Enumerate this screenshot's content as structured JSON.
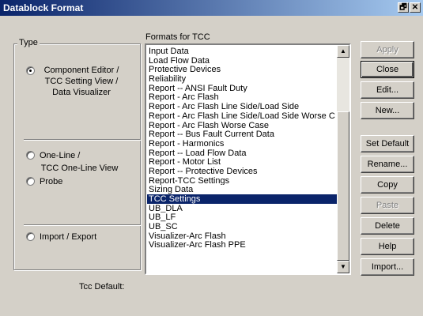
{
  "window": {
    "title": "Datablock Format",
    "restore_glyph": "🗗",
    "close_glyph": "✕"
  },
  "type_group": {
    "legend": "Type",
    "options": [
      {
        "label": "Component Editor /\nTCC Setting View /\nData Visualizer",
        "checked": true
      },
      {
        "label": "One-Line /",
        "sublabel": "TCC One-Line View",
        "checked": false
      },
      {
        "label": "Probe",
        "checked": false
      },
      {
        "label": "Import / Export",
        "checked": false
      }
    ]
  },
  "formats": {
    "label": "Formats for TCC",
    "items": [
      "Input Data",
      "Load Flow Data",
      "Protective Devices",
      "Reliability",
      "Report -- ANSI Fault Duty",
      "Report - Arc Flash",
      "Report - Arc Flash Line Side/Load Side",
      "Report - Arc Flash Line Side/Load Side Worse C",
      "Report - Arc Flash Worse Case",
      "Report -- Bus Fault Current Data",
      "Report - Harmonics",
      "Report -- Load Flow Data",
      "Report - Motor List",
      "Report -- Protective Devices",
      "Report-TCC Settings",
      "Sizing Data",
      "TCC Settings",
      "UB_DLA",
      "UB_LF",
      "UB_SC",
      "Visualizer-Arc Flash",
      "Visualizer-Arc Flash PPE"
    ],
    "selected_index": 16
  },
  "buttons": {
    "apply": "Apply",
    "close": "Close",
    "edit": "Edit...",
    "new": "New...",
    "set_default": "Set Default",
    "rename": "Rename...",
    "copy": "Copy",
    "paste": "Paste",
    "delete": "Delete",
    "help": "Help",
    "import": "Import..."
  },
  "tcc_default": {
    "label": "Tcc Default:"
  }
}
